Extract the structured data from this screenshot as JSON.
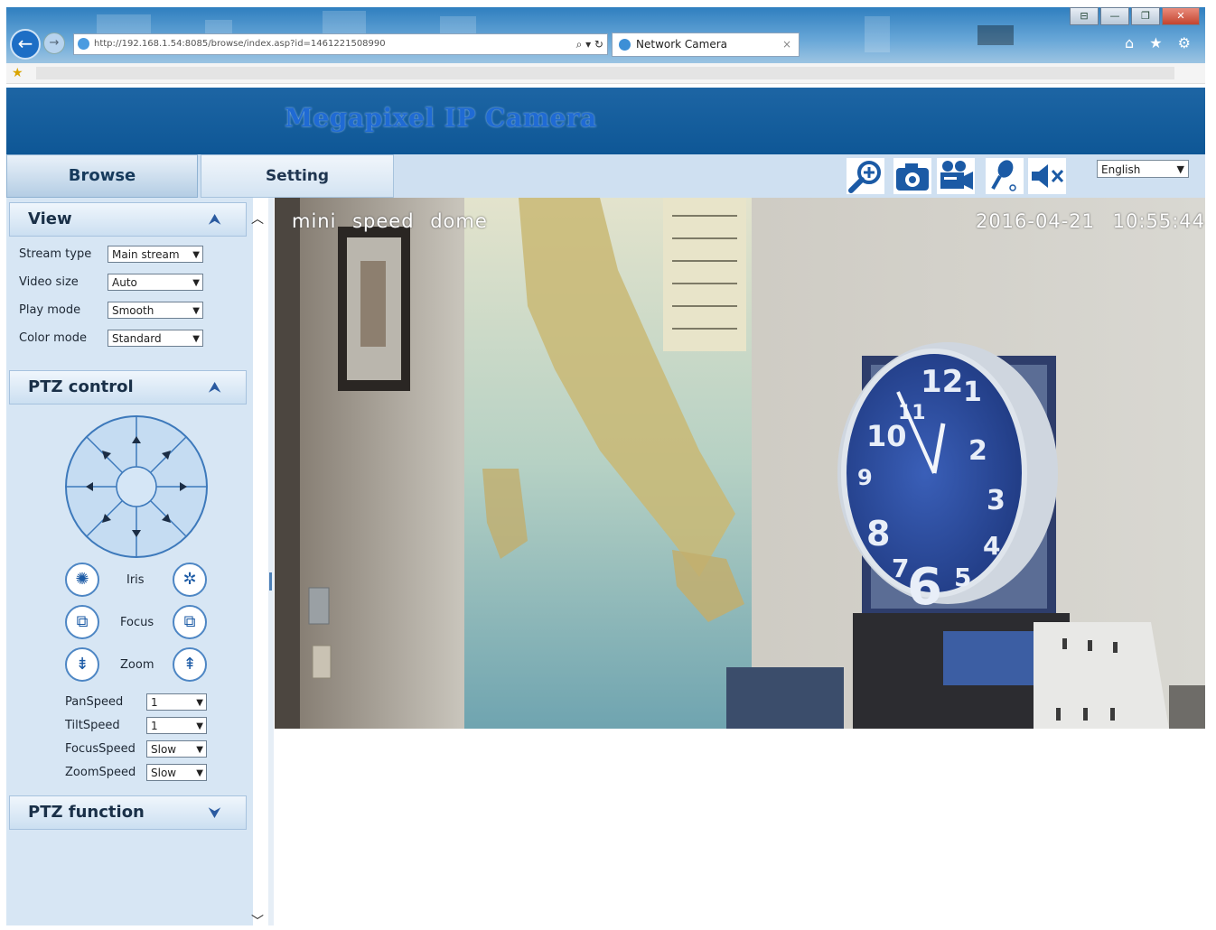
{
  "browser": {
    "url": "http://192.168.1.54:8085/browse/index.asp?id=1461221508990",
    "tab_title": "Network Camera",
    "tab_close": "×",
    "back": "←",
    "forward": "→",
    "address_tools": "⌕ ▾ ↻",
    "right_icons": "⌂ ★ ⚙",
    "window_buttons": [
      "⊟",
      "—",
      "❐",
      "✕"
    ]
  },
  "header": {
    "title": "Megapixel IP Camera"
  },
  "nav": {
    "tabs": [
      {
        "label": "Browse"
      },
      {
        "label": "Setting"
      }
    ],
    "toolbar_icons": [
      "zoom-in-icon",
      "snapshot-camera-icon",
      "record-video-icon",
      "microphone-icon",
      "mute-speaker-icon"
    ],
    "language": "English"
  },
  "view": {
    "title": "View",
    "fields": [
      {
        "label": "Stream type",
        "value": "Main stream"
      },
      {
        "label": "Video size",
        "value": "Auto"
      },
      {
        "label": "Play mode",
        "value": "Smooth"
      },
      {
        "label": "Color mode",
        "value": "Standard"
      }
    ]
  },
  "ptz_control": {
    "title": "PTZ control",
    "iris_label": "Iris",
    "focus_label": "Focus",
    "zoom_label": "Zoom",
    "speeds": [
      {
        "label": "PanSpeed",
        "value": "1"
      },
      {
        "label": "TiltSpeed",
        "value": "1"
      },
      {
        "label": "FocusSpeed",
        "value": "Slow"
      },
      {
        "label": "ZoomSpeed",
        "value": "Slow"
      }
    ]
  },
  "ptz_function": {
    "title": "PTZ function"
  },
  "video": {
    "osd_title": "mini speed dome",
    "osd_timestamp": "2016-04-21 10:55:44",
    "clock_numbers": [
      "12",
      "1",
      "2",
      "3",
      "4",
      "5",
      "6",
      "7",
      "8",
      "9",
      "10",
      "11"
    ]
  },
  "colors": {
    "header": "#0e5796",
    "title_text": "#1f6ad4",
    "panel": "#d7e6f4",
    "icon_blue": "#1b5aa5"
  }
}
